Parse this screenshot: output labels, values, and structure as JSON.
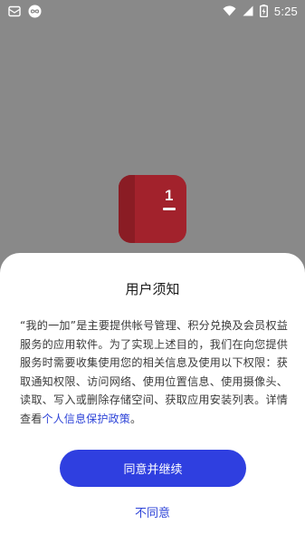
{
  "status_bar": {
    "time": "5:25",
    "left_icons": [
      "mail-icon",
      "infinity-badge-icon"
    ],
    "right_icons": [
      "wifi-icon",
      "cellular-signal-icon",
      "battery-charging-icon"
    ]
  },
  "splash": {
    "logo_digit": "1",
    "logo_color": "#a2222c"
  },
  "dialog": {
    "title": "用户须知",
    "body_text": "“我的一加”是主要提供帐号管理、积分兑换及会员权益服务的应用软件。为了实现上述目的，我们在向您提供服务时需要收集使用您的相关信息及使用以下权限：获取通知权限、访问网络、使用位置信息、使用摄像头、读取、写入或删除存储空间、获取应用安装列表。详情查看",
    "policy_link": "个人信息保护政策",
    "body_end": "。",
    "agree_label": "同意并继续",
    "disagree_label": "不同意",
    "accent_color": "#2f3fe0"
  }
}
